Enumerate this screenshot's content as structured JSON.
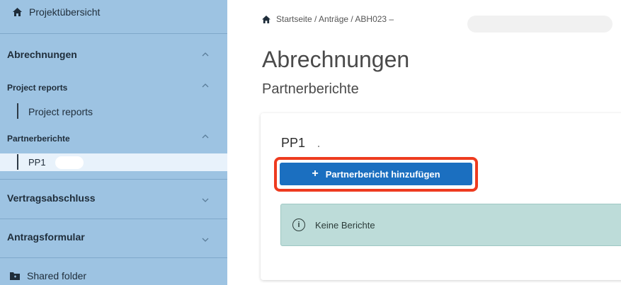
{
  "sidebar": {
    "top_item": {
      "label": "Projektübersicht",
      "icon": "home-icon"
    },
    "sections": [
      {
        "label": "Abrechnungen",
        "icon": "chevron-up-icon"
      },
      {
        "label": "Vertragsabschluss",
        "icon": "chevron-down-icon"
      },
      {
        "label": "Antragsformular",
        "icon": "chevron-down-icon"
      }
    ],
    "subsections": [
      {
        "label": "Project reports",
        "icon": "chevron-up-icon"
      },
      {
        "label": "Partnerberichte",
        "icon": "chevron-up-icon"
      }
    ],
    "leaves": [
      {
        "label": "Project reports"
      },
      {
        "label": "PP1"
      }
    ],
    "shared_folder": {
      "label": "Shared folder",
      "icon": "folder-icon"
    }
  },
  "breadcrumb": {
    "icon": "home-icon",
    "text": "Startseite / Anträge / ABH023 –"
  },
  "main": {
    "title": "Abrechnungen",
    "subtitle": "Partnerberichte",
    "card": {
      "title": "PP1",
      "add_button": "Partnerbericht hinzufügen",
      "add_button_icon": "+",
      "alert_icon": "i",
      "alert_text": "Keine Berichte"
    }
  },
  "colors": {
    "sidebar_bg": "#9dc3e2",
    "active_leaf_bg": "#e8f2fb",
    "primary_button": "#1b6fc0",
    "highlight_border": "#ee3b1f",
    "alert_bg": "#bddcd9"
  }
}
